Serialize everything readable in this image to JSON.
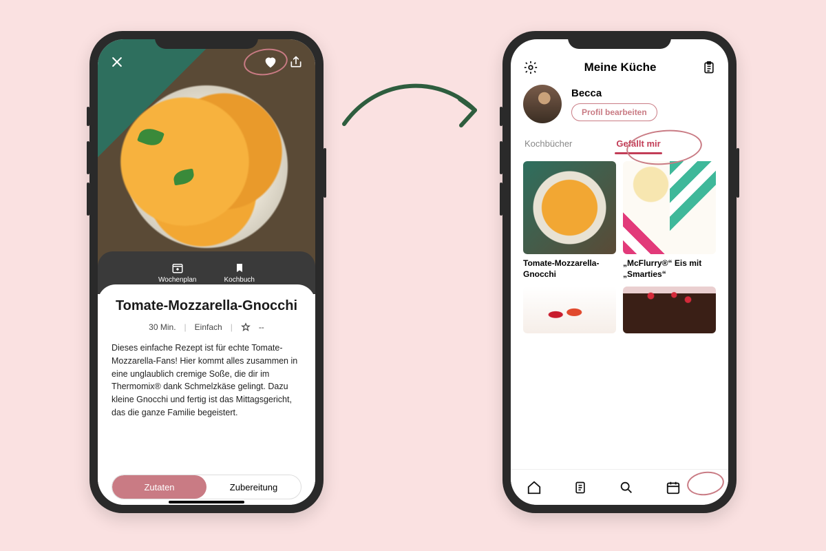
{
  "left": {
    "actions": {
      "wochenplan": "Wochenplan",
      "kochbuch": "Kochbuch"
    },
    "recipe": {
      "title": "Tomate-Mozzarella-Gnocchi",
      "duration": "30 Min.",
      "difficulty": "Einfach",
      "rating": "--",
      "description": "Dieses einfache Rezept ist für echte Tomate-Mozzarella-Fans! Hier kommt alles zusammen in eine unglaublich cremige Soße, die dir im Thermomix® dank Schmelzkäse gelingt. Dazu kleine Gnocchi und fertig ist das Mittagsgericht, das die ganze Familie begeistert."
    },
    "segmented": {
      "ingredients": "Zutaten",
      "preparation": "Zubereitung"
    }
  },
  "right": {
    "header_title": "Meine Küche",
    "profile": {
      "name": "Becca",
      "edit": "Profil bearbeiten"
    },
    "tabs": {
      "cookbooks": "Kochbücher",
      "likes": "Gefällt mir"
    },
    "cards": [
      {
        "title": "Tomate-Mozzarella-Gnocchi"
      },
      {
        "title": "„McFlurry®“ Eis mit „Smarties“"
      }
    ]
  }
}
